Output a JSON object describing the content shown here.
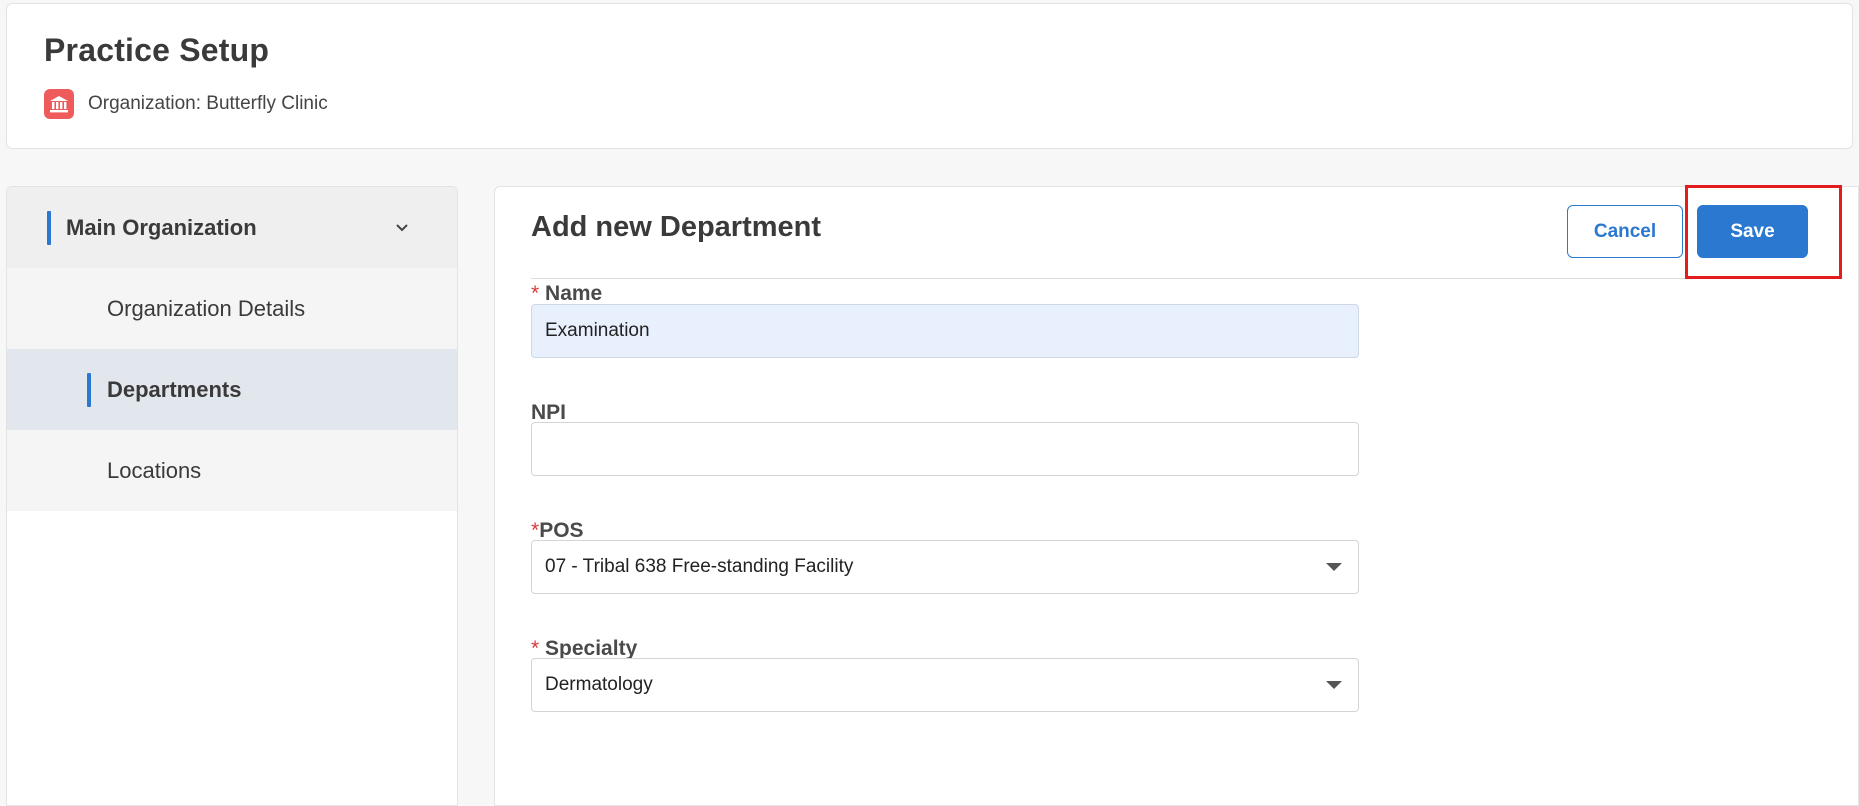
{
  "header": {
    "title": "Practice Setup",
    "organization_text": "Organization: Butterfly Clinic",
    "organization_icon": "institution-icon"
  },
  "sidebar": {
    "group_label": "Main Organization",
    "items": [
      {
        "label": "Organization Details",
        "active": false
      },
      {
        "label": "Departments",
        "active": true
      },
      {
        "label": "Locations",
        "active": false
      }
    ]
  },
  "form": {
    "title": "Add new Department",
    "cancel_label": "Cancel",
    "save_label": "Save",
    "required_marker": "*",
    "fields": {
      "name": {
        "label": "Name",
        "value": "Examination"
      },
      "npi": {
        "label": "NPI",
        "value": ""
      },
      "pos": {
        "label": "POS",
        "value": "07 - Tribal 638 Free-standing Facility"
      },
      "specialty": {
        "label": "Specialty",
        "value": "Dermatology"
      }
    }
  },
  "colors": {
    "accent": "#2a78d0",
    "highlight": "#e41c1c",
    "org_icon_bg": "#ef5a5a",
    "required": "#d93a3a"
  }
}
